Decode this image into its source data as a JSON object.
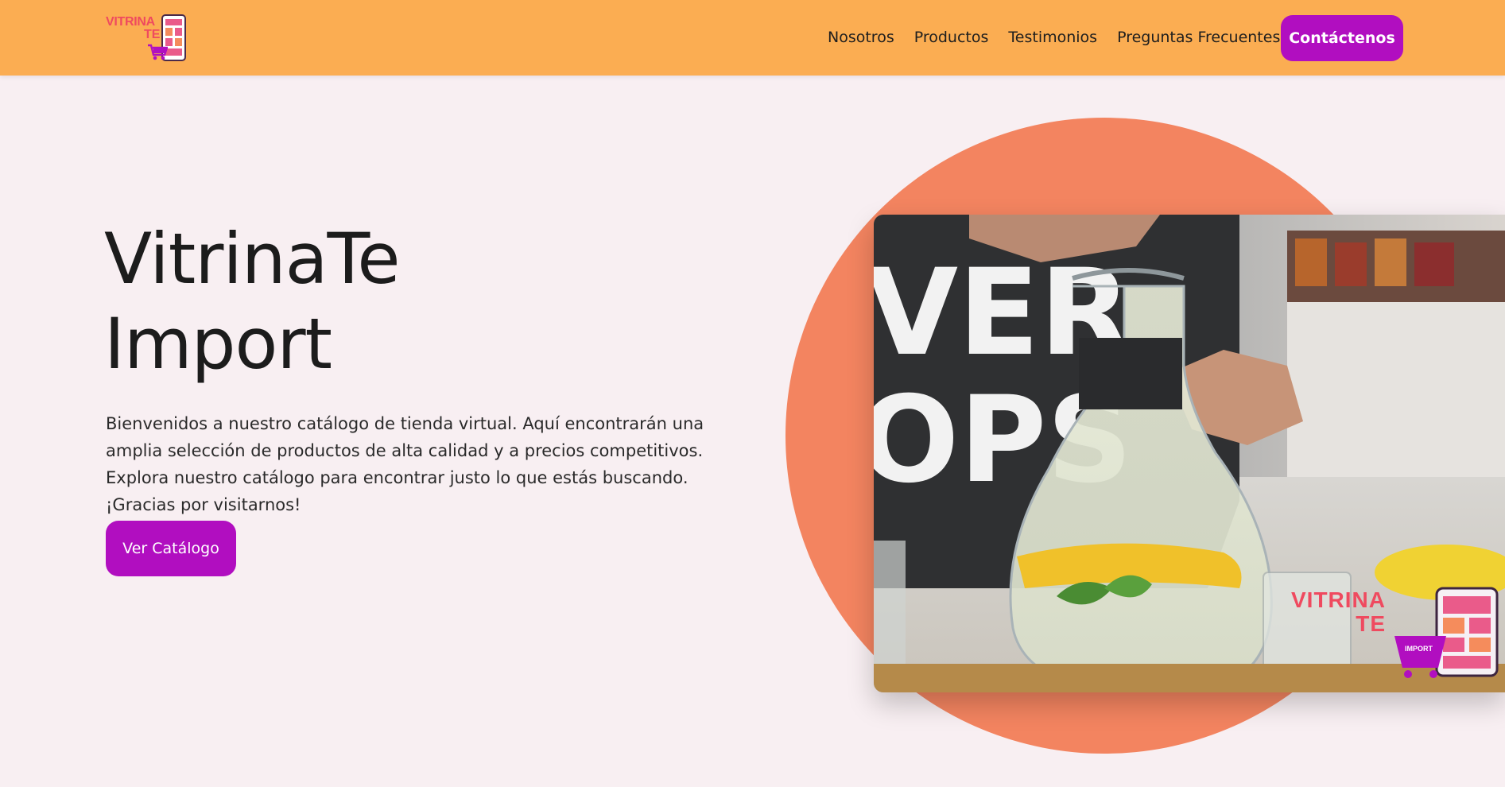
{
  "brand": {
    "logo_line1": "VITRINA",
    "logo_line2": "TE",
    "image_logo_line1": "VITRINA",
    "image_logo_line2": "TE",
    "image_logo_badge": "IMPORT"
  },
  "nav": {
    "items": [
      {
        "label": "Nosotros"
      },
      {
        "label": "Productos"
      },
      {
        "label": "Testimonios"
      },
      {
        "label": "Preguntas Frecuentes"
      }
    ],
    "contact_label": "Contáctenos"
  },
  "hero": {
    "title_line1": "VitrinaTe",
    "title_line2": "Import",
    "description": "Bienvenidos a nuestro catálogo de tienda virtual. Aquí encontrarán una amplia selección de productos de alta calidad y a precios competitivos. Explora nuestro catálogo para encontrar justo lo que estás buscando. ¡Gracias por visitarnos!",
    "cta_label": "Ver Catálogo",
    "shirt_text_line1": "VER",
    "shirt_text_line2": "OPS"
  },
  "colors": {
    "navbar": "#fbad52",
    "accent": "#b10ec0",
    "circle": "#f38460",
    "background": "#f8eff2",
    "logo_text": "#ef4a5f"
  },
  "icons": {
    "logo_phone": "phone-icon",
    "logo_cart": "cart-icon"
  }
}
